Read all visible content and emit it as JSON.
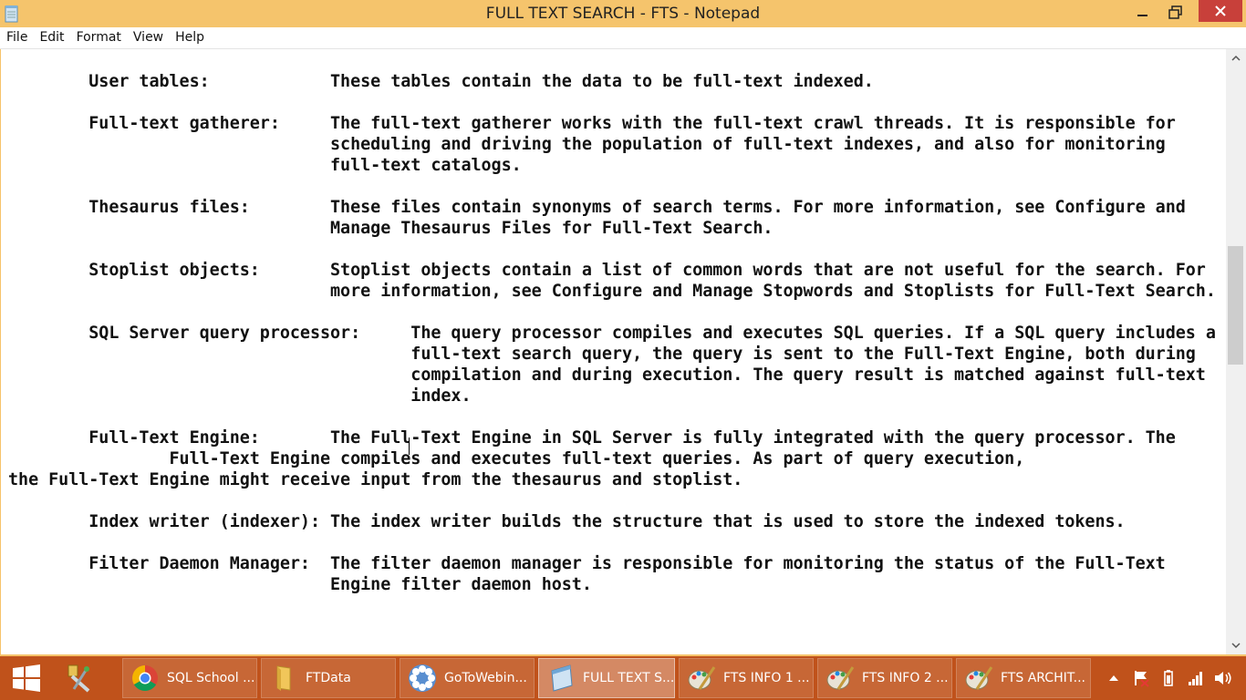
{
  "window": {
    "title": "FULL TEXT SEARCH - FTS - Notepad"
  },
  "menu": {
    "items": [
      "File",
      "Edit",
      "Format",
      "View",
      "Help"
    ]
  },
  "document": {
    "text": "        User tables:            These tables contain the data to be full-text indexed.\n\n        Full-text gatherer:     The full-text gatherer works with the full-text crawl threads. It is responsible for\n                                scheduling and driving the population of full-text indexes, and also for monitoring\n                                full-text catalogs.\n\n        Thesaurus files:        These files contain synonyms of search terms. For more information, see Configure and\n                                Manage Thesaurus Files for Full-Text Search.\n\n        Stoplist objects:       Stoplist objects contain a list of common words that are not useful for the search. For\n                                more information, see Configure and Manage Stopwords and Stoplists for Full-Text Search.\n\n        SQL Server query processor:     The query processor compiles and executes SQL queries. If a SQL query includes a\n                                        full-text search query, the query is sent to the Full-Text Engine, both during\n                                        compilation and during execution. The query result is matched against full-text\n                                        index.\n\n        Full-Text Engine:       The Full-Text Engine in SQL Server is fully integrated with the query processor. The\n                Full-Text Engine compiles and executes full-text queries. As part of query execution,\nthe Full-Text Engine might receive input from the thesaurus and stoplist.\n\n        Index writer (indexer): The index writer builds the structure that is used to store the indexed tokens.\n\n        Filter Daemon Manager:  The filter daemon manager is responsible for monitoring the status of the Full-Text\n                                Engine filter daemon host."
  },
  "taskbar": {
    "items": [
      {
        "label": "",
        "icon": "tools-icon"
      },
      {
        "label": "SQL School ...",
        "icon": "chrome-icon"
      },
      {
        "label": "FTData",
        "icon": "folder-icon"
      },
      {
        "label": "GoToWebin...",
        "icon": "gotowebinar-icon"
      },
      {
        "label": "FULL TEXT S...",
        "icon": "notepad-icon"
      },
      {
        "label": "FTS INFO 1 ...",
        "icon": "paint-icon"
      },
      {
        "label": "FTS INFO 2 ...",
        "icon": "paint-icon"
      },
      {
        "label": "FTS ARCHIT...",
        "icon": "paint-icon"
      }
    ]
  },
  "colors": {
    "titlebar": "#f5c46c",
    "close_button": "#c8403a",
    "taskbar": "#c0521b"
  }
}
